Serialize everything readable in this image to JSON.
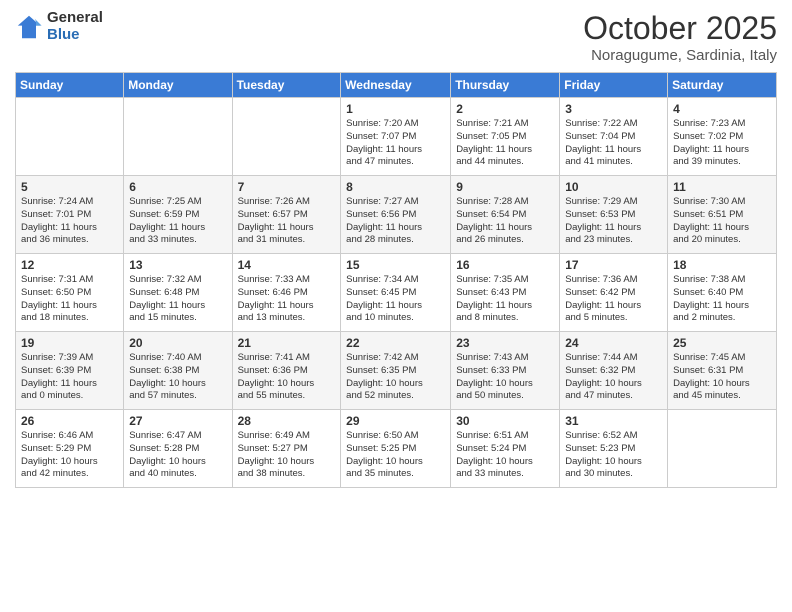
{
  "logo": {
    "general": "General",
    "blue": "Blue"
  },
  "title": "October 2025",
  "location": "Noragugume, Sardinia, Italy",
  "weekdays": [
    "Sunday",
    "Monday",
    "Tuesday",
    "Wednesday",
    "Thursday",
    "Friday",
    "Saturday"
  ],
  "weeks": [
    [
      {
        "day": "",
        "info": ""
      },
      {
        "day": "",
        "info": ""
      },
      {
        "day": "",
        "info": ""
      },
      {
        "day": "1",
        "info": "Sunrise: 7:20 AM\nSunset: 7:07 PM\nDaylight: 11 hours\nand 47 minutes."
      },
      {
        "day": "2",
        "info": "Sunrise: 7:21 AM\nSunset: 7:05 PM\nDaylight: 11 hours\nand 44 minutes."
      },
      {
        "day": "3",
        "info": "Sunrise: 7:22 AM\nSunset: 7:04 PM\nDaylight: 11 hours\nand 41 minutes."
      },
      {
        "day": "4",
        "info": "Sunrise: 7:23 AM\nSunset: 7:02 PM\nDaylight: 11 hours\nand 39 minutes."
      }
    ],
    [
      {
        "day": "5",
        "info": "Sunrise: 7:24 AM\nSunset: 7:01 PM\nDaylight: 11 hours\nand 36 minutes."
      },
      {
        "day": "6",
        "info": "Sunrise: 7:25 AM\nSunset: 6:59 PM\nDaylight: 11 hours\nand 33 minutes."
      },
      {
        "day": "7",
        "info": "Sunrise: 7:26 AM\nSunset: 6:57 PM\nDaylight: 11 hours\nand 31 minutes."
      },
      {
        "day": "8",
        "info": "Sunrise: 7:27 AM\nSunset: 6:56 PM\nDaylight: 11 hours\nand 28 minutes."
      },
      {
        "day": "9",
        "info": "Sunrise: 7:28 AM\nSunset: 6:54 PM\nDaylight: 11 hours\nand 26 minutes."
      },
      {
        "day": "10",
        "info": "Sunrise: 7:29 AM\nSunset: 6:53 PM\nDaylight: 11 hours\nand 23 minutes."
      },
      {
        "day": "11",
        "info": "Sunrise: 7:30 AM\nSunset: 6:51 PM\nDaylight: 11 hours\nand 20 minutes."
      }
    ],
    [
      {
        "day": "12",
        "info": "Sunrise: 7:31 AM\nSunset: 6:50 PM\nDaylight: 11 hours\nand 18 minutes."
      },
      {
        "day": "13",
        "info": "Sunrise: 7:32 AM\nSunset: 6:48 PM\nDaylight: 11 hours\nand 15 minutes."
      },
      {
        "day": "14",
        "info": "Sunrise: 7:33 AM\nSunset: 6:46 PM\nDaylight: 11 hours\nand 13 minutes."
      },
      {
        "day": "15",
        "info": "Sunrise: 7:34 AM\nSunset: 6:45 PM\nDaylight: 11 hours\nand 10 minutes."
      },
      {
        "day": "16",
        "info": "Sunrise: 7:35 AM\nSunset: 6:43 PM\nDaylight: 11 hours\nand 8 minutes."
      },
      {
        "day": "17",
        "info": "Sunrise: 7:36 AM\nSunset: 6:42 PM\nDaylight: 11 hours\nand 5 minutes."
      },
      {
        "day": "18",
        "info": "Sunrise: 7:38 AM\nSunset: 6:40 PM\nDaylight: 11 hours\nand 2 minutes."
      }
    ],
    [
      {
        "day": "19",
        "info": "Sunrise: 7:39 AM\nSunset: 6:39 PM\nDaylight: 11 hours\nand 0 minutes."
      },
      {
        "day": "20",
        "info": "Sunrise: 7:40 AM\nSunset: 6:38 PM\nDaylight: 10 hours\nand 57 minutes."
      },
      {
        "day": "21",
        "info": "Sunrise: 7:41 AM\nSunset: 6:36 PM\nDaylight: 10 hours\nand 55 minutes."
      },
      {
        "day": "22",
        "info": "Sunrise: 7:42 AM\nSunset: 6:35 PM\nDaylight: 10 hours\nand 52 minutes."
      },
      {
        "day": "23",
        "info": "Sunrise: 7:43 AM\nSunset: 6:33 PM\nDaylight: 10 hours\nand 50 minutes."
      },
      {
        "day": "24",
        "info": "Sunrise: 7:44 AM\nSunset: 6:32 PM\nDaylight: 10 hours\nand 47 minutes."
      },
      {
        "day": "25",
        "info": "Sunrise: 7:45 AM\nSunset: 6:31 PM\nDaylight: 10 hours\nand 45 minutes."
      }
    ],
    [
      {
        "day": "26",
        "info": "Sunrise: 6:46 AM\nSunset: 5:29 PM\nDaylight: 10 hours\nand 42 minutes."
      },
      {
        "day": "27",
        "info": "Sunrise: 6:47 AM\nSunset: 5:28 PM\nDaylight: 10 hours\nand 40 minutes."
      },
      {
        "day": "28",
        "info": "Sunrise: 6:49 AM\nSunset: 5:27 PM\nDaylight: 10 hours\nand 38 minutes."
      },
      {
        "day": "29",
        "info": "Sunrise: 6:50 AM\nSunset: 5:25 PM\nDaylight: 10 hours\nand 35 minutes."
      },
      {
        "day": "30",
        "info": "Sunrise: 6:51 AM\nSunset: 5:24 PM\nDaylight: 10 hours\nand 33 minutes."
      },
      {
        "day": "31",
        "info": "Sunrise: 6:52 AM\nSunset: 5:23 PM\nDaylight: 10 hours\nand 30 minutes."
      },
      {
        "day": "",
        "info": ""
      }
    ]
  ]
}
